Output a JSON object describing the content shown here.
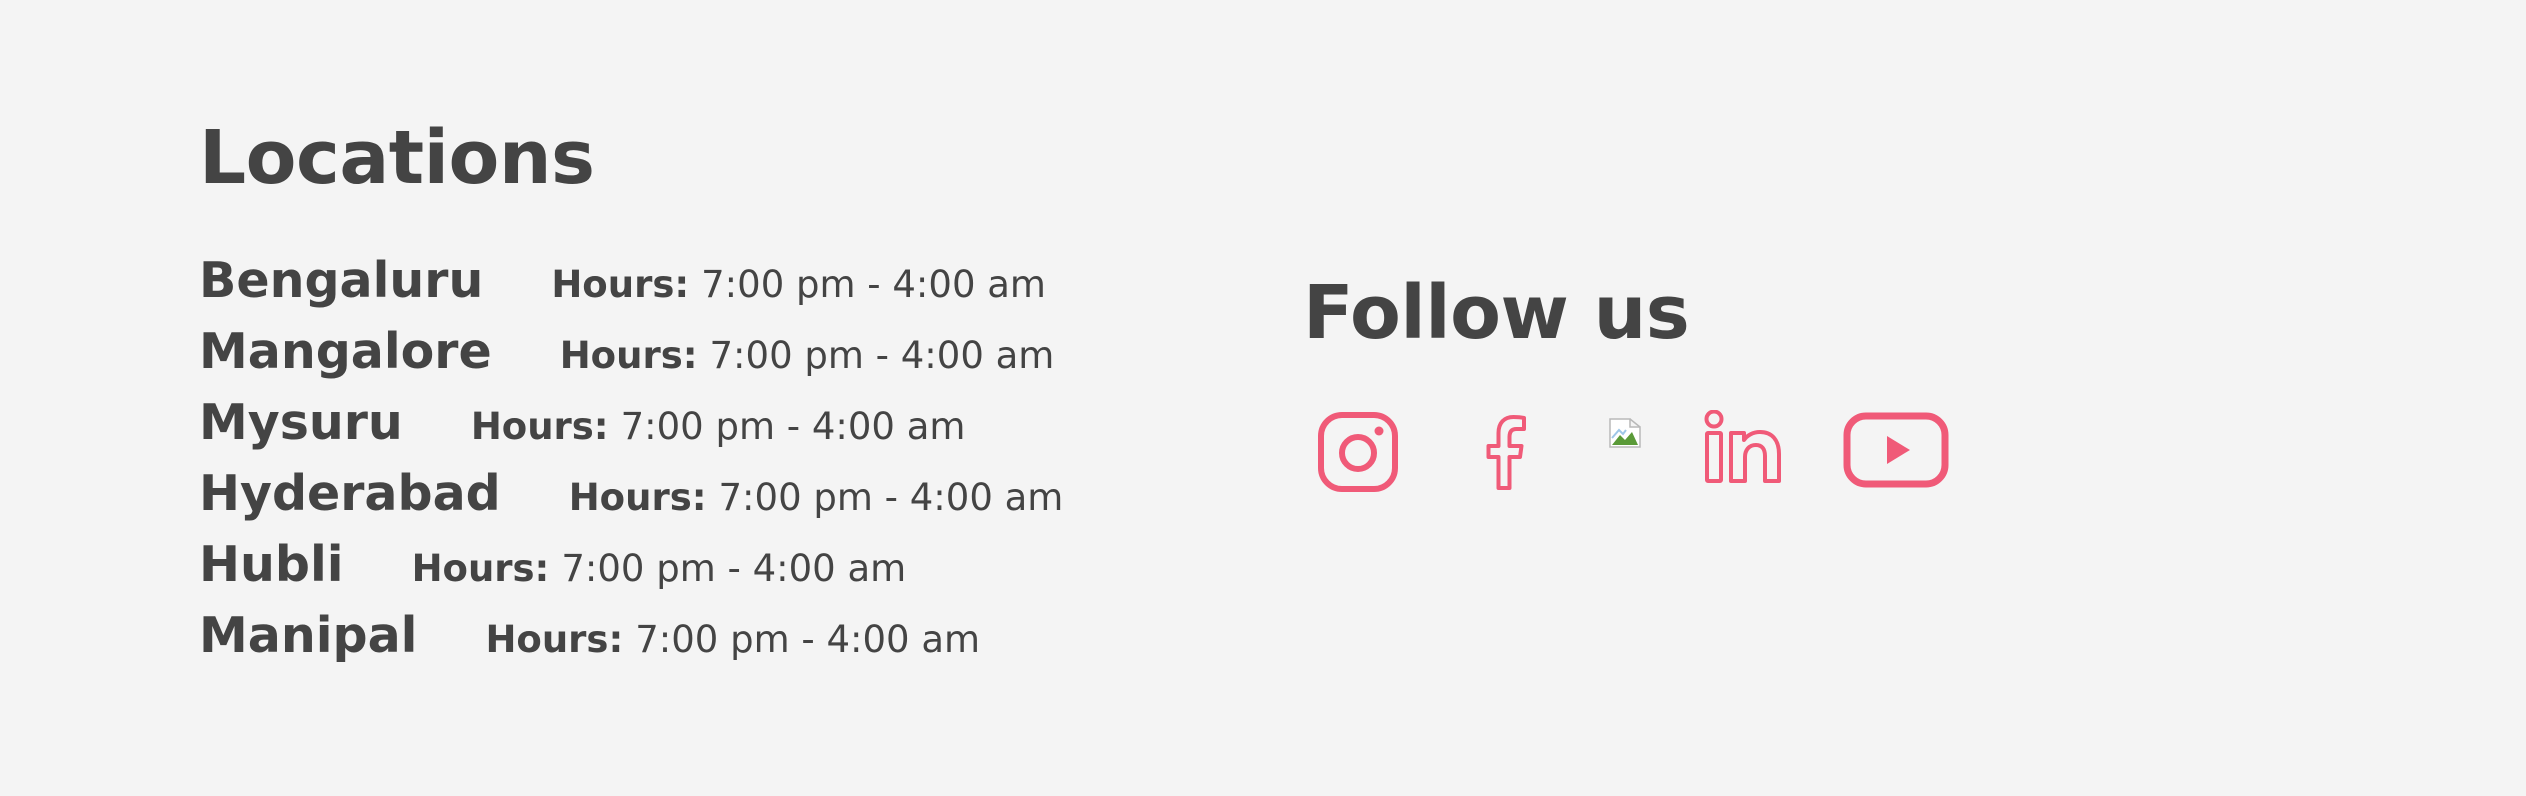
{
  "locations": {
    "title": "Locations",
    "items": [
      {
        "city": "Bengaluru",
        "hours_label": "Hours:",
        "hours": "7:00 pm - 4:00 am"
      },
      {
        "city": "Mangalore",
        "hours_label": "Hours:",
        "hours": "7:00 pm - 4:00 am"
      },
      {
        "city": "Mysuru",
        "hours_label": "Hours:",
        "hours": "7:00 pm - 4:00 am"
      },
      {
        "city": "Hyderabad",
        "hours_label": "Hours:",
        "hours": "7:00 pm - 4:00 am"
      },
      {
        "city": "Hubli",
        "hours_label": "Hours:",
        "hours": "7:00 pm - 4:00 am"
      },
      {
        "city": "Manipal",
        "hours_label": "Hours:",
        "hours": "7:00 pm - 4:00 am"
      }
    ]
  },
  "follow": {
    "title": "Follow us",
    "icons": [
      "instagram-icon",
      "facebook-icon",
      "broken-image-icon",
      "linkedin-icon",
      "youtube-icon"
    ]
  },
  "colors": {
    "background": "#f4f4f4",
    "text": "#444444",
    "accent": "#f05a78"
  }
}
